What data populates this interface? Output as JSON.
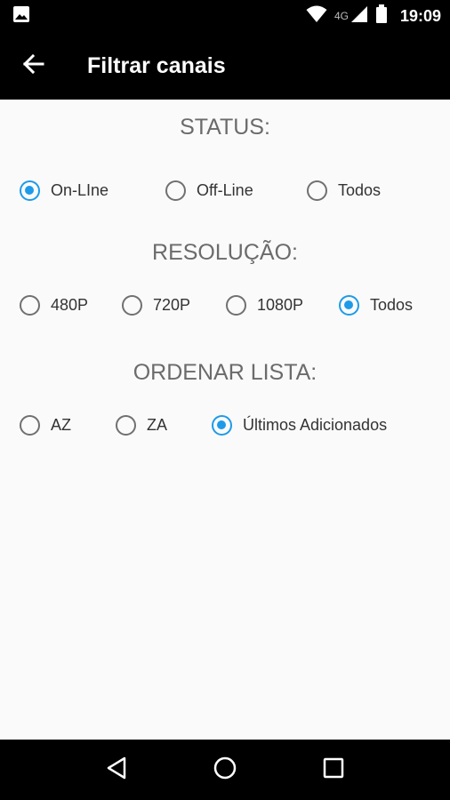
{
  "status_bar": {
    "time": "19:09",
    "network": "4G"
  },
  "app_bar": {
    "title": "Filtrar canais"
  },
  "sections": {
    "status": {
      "title": "STATUS:",
      "options": [
        "On-LIne",
        "Off-Line",
        "Todos"
      ],
      "selected": "On-LIne"
    },
    "resolucao": {
      "title": "RESOLUÇÃO:",
      "options": [
        "480P",
        "720P",
        "1080P",
        "Todos"
      ],
      "selected": "Todos"
    },
    "ordenar": {
      "title": "ORDENAR LISTA:",
      "options": [
        "AZ",
        "ZA",
        "Últimos Adicionados"
      ],
      "selected": "Últimos Adicionados"
    }
  },
  "colors": {
    "accent": "#1e9be8",
    "app_bar": "#000000",
    "background": "#fafafa"
  },
  "icons": {
    "status_left": "image-icon",
    "status_right": [
      "wifi-icon",
      "signal-icon",
      "battery-icon"
    ],
    "back": "arrow-back-icon",
    "nav": [
      "back-triangle-icon",
      "home-circle-icon",
      "recents-square-icon"
    ]
  }
}
